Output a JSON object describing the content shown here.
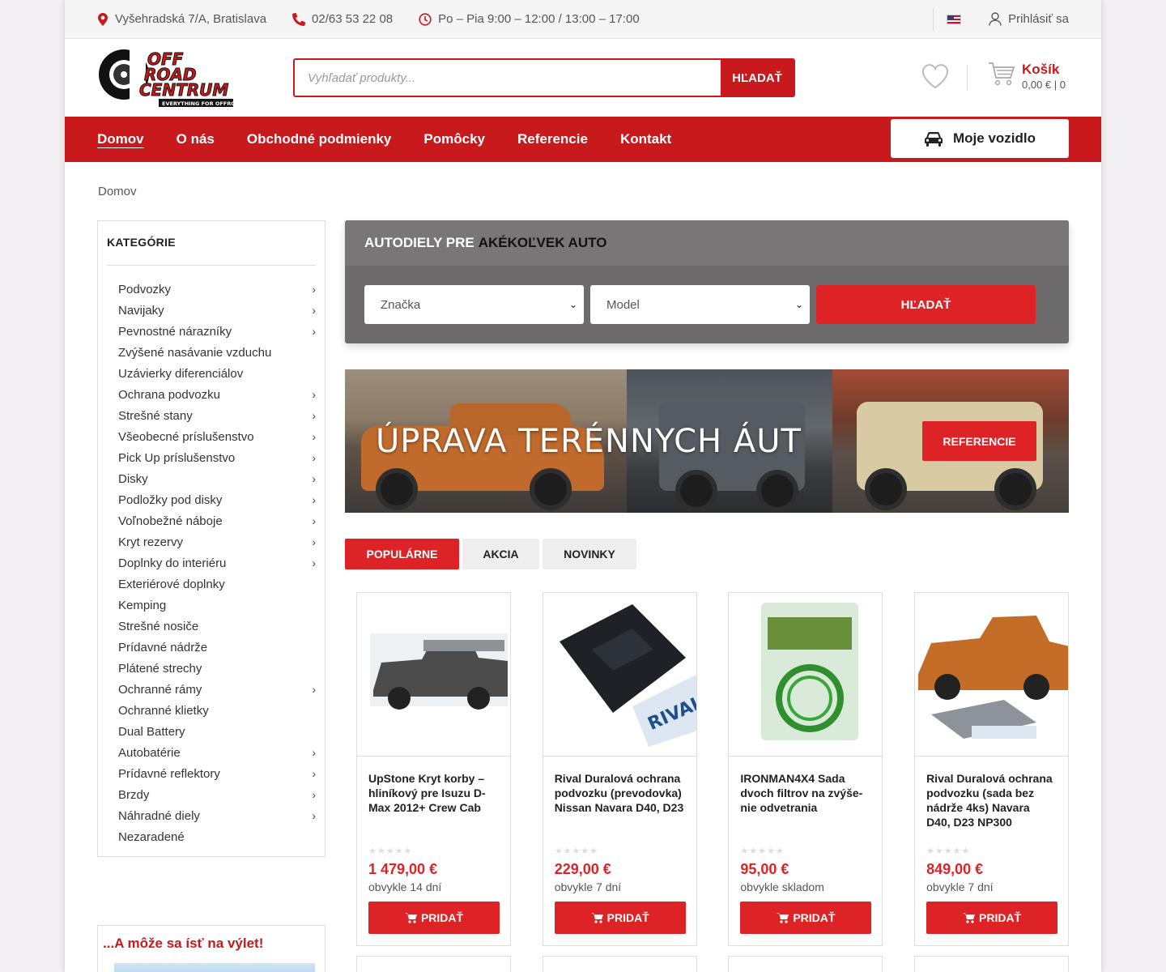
{
  "topbar": {
    "address": "Vyšehradská 7/A, Bratislava",
    "phone": "02/63 53 22 08",
    "hours": "Po – Pia 9:00 – 12:00 / 13:00 – 17:00",
    "login": "Prihlásiť sa"
  },
  "header": {
    "logo_text": "OFF ROAD CENTRUM",
    "logo_tagline": "EVERYTHING FOR OFFROAD",
    "search_placeholder": "Vyhľadať produkty...",
    "search_button": "HĽADAŤ",
    "cart_title": "Košík",
    "cart_summary": "0,00 € | 0"
  },
  "nav": {
    "items": [
      "Domov",
      "O nás",
      "Obchodné podmienky",
      "Pomôcky",
      "Referencie",
      "Kontakt"
    ],
    "my_vehicle": "Moje vozidlo"
  },
  "breadcrumb": "Domov",
  "categories": {
    "title": "KATEGÓRIE",
    "items": [
      {
        "label": "Podvozky",
        "sub": true
      },
      {
        "label": "Navijaky",
        "sub": true
      },
      {
        "label": "Pevnostné nárazníky",
        "sub": true
      },
      {
        "label": "Zvýšené nasávanie vzduchu",
        "sub": false
      },
      {
        "label": "Uzávierky diferenciálov",
        "sub": false
      },
      {
        "label": "Ochrana podvozku",
        "sub": true
      },
      {
        "label": "Strešné stany",
        "sub": true
      },
      {
        "label": "Všeobecné príslušenstvo",
        "sub": true
      },
      {
        "label": "Pick Up príslušenstvo",
        "sub": true
      },
      {
        "label": "Disky",
        "sub": true
      },
      {
        "label": "Podložky pod disky",
        "sub": true
      },
      {
        "label": "Voľnobežné náboje",
        "sub": true
      },
      {
        "label": "Kryt rezervy",
        "sub": true
      },
      {
        "label": "Doplnky do interiéru",
        "sub": true
      },
      {
        "label": "Exteriérové doplnky",
        "sub": false
      },
      {
        "label": "Kemping",
        "sub": false
      },
      {
        "label": "Strešné nosiče",
        "sub": false
      },
      {
        "label": "Prídavné nádrže",
        "sub": false
      },
      {
        "label": "Plátené strechy",
        "sub": false
      },
      {
        "label": "Ochranné rámy",
        "sub": true
      },
      {
        "label": "Ochranné klietky",
        "sub": false
      },
      {
        "label": "Dual Battery",
        "sub": false
      },
      {
        "label": "Autobatérie",
        "sub": true
      },
      {
        "label": "Prídavné reflektory",
        "sub": true
      },
      {
        "label": "Brzdy",
        "sub": true
      },
      {
        "label": "Náhradné diely",
        "sub": true
      },
      {
        "label": "Nezaradené",
        "sub": false
      }
    ]
  },
  "trip_widget": {
    "title": "...A môže sa ísť na výlet!"
  },
  "finder": {
    "title_prefix": "AUTODIELY PRE",
    "title_highlight": "AKÉKOĽVEK AUTO",
    "brand_select": "Značka",
    "model_select": "Model",
    "button": "HĽADAŤ"
  },
  "banner": {
    "title": "ÚPRAVA TERÉNNYCH ÁUT",
    "button": "REFERENCIE"
  },
  "tabs": [
    "POPULÁRNE",
    "AKCIA",
    "NOVINKY"
  ],
  "products": [
    {
      "name": "UpStone Kryt korby – hliníkový pre Isuzu D-Max 2012+ Crew Cab",
      "price": "1 479,00 €",
      "availability": "obvykle 14 dní",
      "button": "PRIDAŤ",
      "stars": "★★★★★"
    },
    {
      "name": "Rival Duralová ochrana podvozku (prevodovka) Nissan Navara D40, D23",
      "price": "229,00 €",
      "availability": "obvykle 7 dní",
      "button": "PRIDAŤ",
      "stars": "★★★★★"
    },
    {
      "name": "IRONMAN4X4 Sada dvoch filtrov na zvýše-nie odvetrania",
      "price": "95,00 €",
      "availability": "obvykle skladom",
      "button": "PRIDAŤ",
      "stars": "★★★★★"
    },
    {
      "name": "Rival Duralová ochrana podvozku (sada bez nádrže 4ks) Navara D40, D23 NP300",
      "price": "849,00 €",
      "availability": "obvykle 7 dní",
      "button": "PRIDAŤ",
      "stars": "★★★★★"
    }
  ],
  "colors": {
    "brand_red": "#c8191c",
    "accent_red": "#dd2326",
    "finder_gray": "#6e6b6c"
  }
}
